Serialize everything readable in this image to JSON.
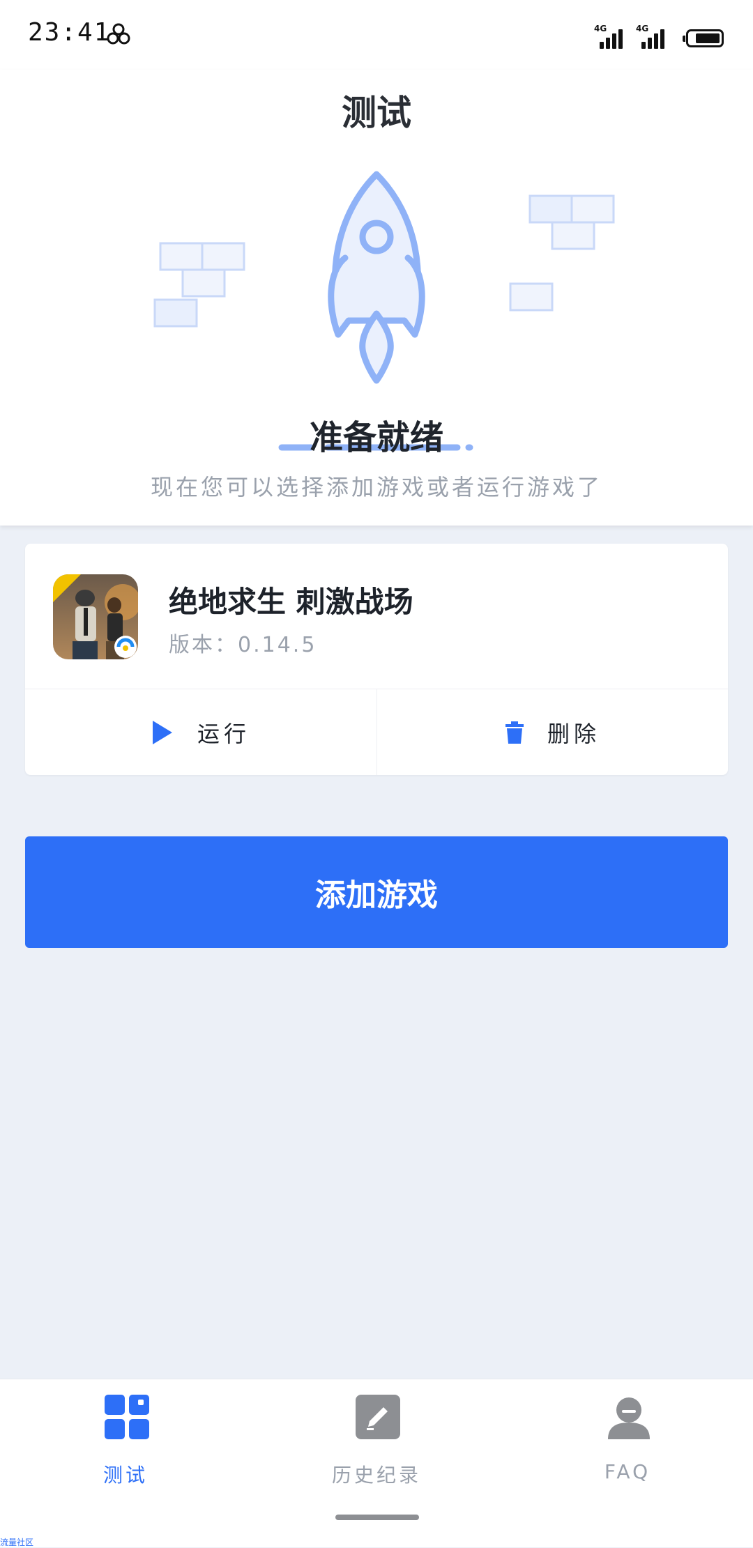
{
  "status_bar": {
    "time": "23:41",
    "network_labels": [
      "4G",
      "4G"
    ]
  },
  "header": {
    "title": "测试",
    "ready_title": "准备就绪",
    "ready_subtitle": "现在您可以选择添加游戏或者运行游戏了"
  },
  "game_card": {
    "name": "绝地求生 刺激战场",
    "version": "版本：0.14.5",
    "actions": {
      "run_label": "运行",
      "delete_label": "删除"
    }
  },
  "add_game_button": {
    "label": "添加游戏"
  },
  "bottom_nav": {
    "items": [
      {
        "label": "测试",
        "icon": "grid-icon",
        "active": true
      },
      {
        "label": "历史纪录",
        "icon": "edit-icon",
        "active": false
      },
      {
        "label": "FAQ",
        "icon": "user-icon",
        "active": false
      }
    ]
  },
  "watermark": "流量社区",
  "colors": {
    "accent": "#2d6ff7",
    "background": "#ecf0f7",
    "illustration": "#8fb2f7",
    "text_primary": "#1d222a",
    "text_secondary": "#9aa1ac"
  }
}
